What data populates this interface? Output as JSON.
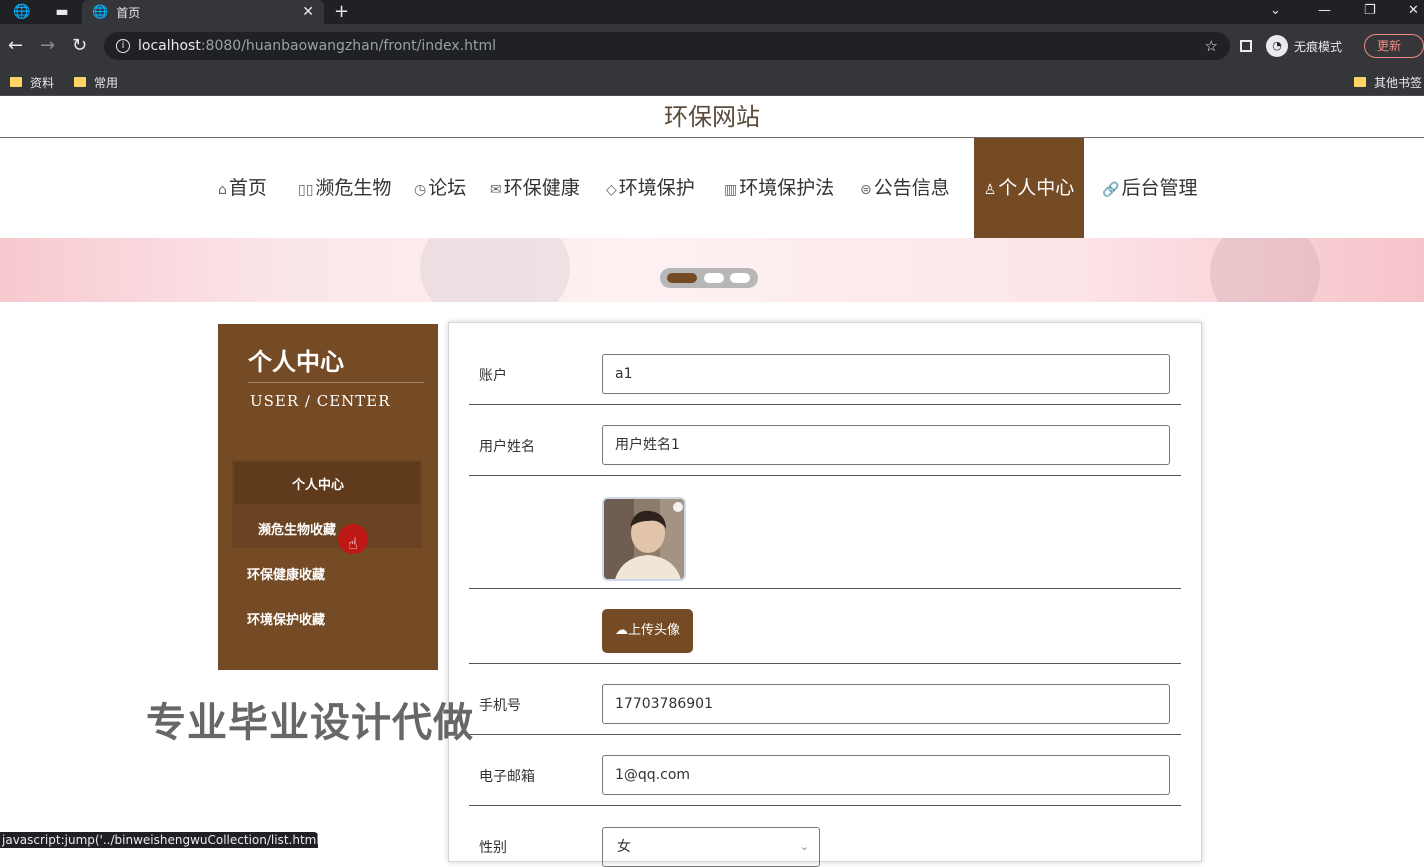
{
  "browser": {
    "tab_title": "首页",
    "tab_close": "✕",
    "new_tab": "+",
    "url_host": "localhost",
    "url_path": ":8080/huanbaowangzhan/front/index.html",
    "incognito_label": "无痕模式",
    "update_label": "更新",
    "bookmarks": [
      "资料",
      "常用"
    ],
    "other_bookmarks": "其他书签",
    "status_url": "javascript:jump('../binweishengwuCollection/list.html')"
  },
  "site": {
    "title": "环保网站",
    "nav": [
      {
        "label": "首页",
        "icon": "⌂"
      },
      {
        "label": "濒危生物",
        "icon": "▯▯"
      },
      {
        "label": "论坛",
        "icon": "◷"
      },
      {
        "label": "环保健康",
        "icon": "✉"
      },
      {
        "label": "环境保护",
        "icon": "◇"
      },
      {
        "label": "环境保护法",
        "icon": "▥"
      },
      {
        "label": "公告信息",
        "icon": "⊜"
      },
      {
        "label": "个人中心",
        "icon": "♙"
      },
      {
        "label": "后台管理",
        "icon": "🔗"
      }
    ],
    "active_nav": "个人中心"
  },
  "sidebar": {
    "title": "个人中心",
    "subtitle": "USER / CENTER",
    "items": [
      "个人中心",
      "濒危生物收藏",
      "环保健康收藏",
      "环境保护收藏"
    ]
  },
  "form": {
    "account_label": "账户",
    "account_value": "a1",
    "name_label": "用户姓名",
    "name_value": "用户姓名1",
    "upload_label": "上传头像",
    "phone_label": "手机号",
    "phone_value": "17703786901",
    "email_label": "电子邮箱",
    "email_value": "1@qq.com",
    "gender_label": "性别",
    "gender_value": "女"
  },
  "watermark": "专业毕业设计代做",
  "colors": {
    "accent": "#744b24"
  }
}
